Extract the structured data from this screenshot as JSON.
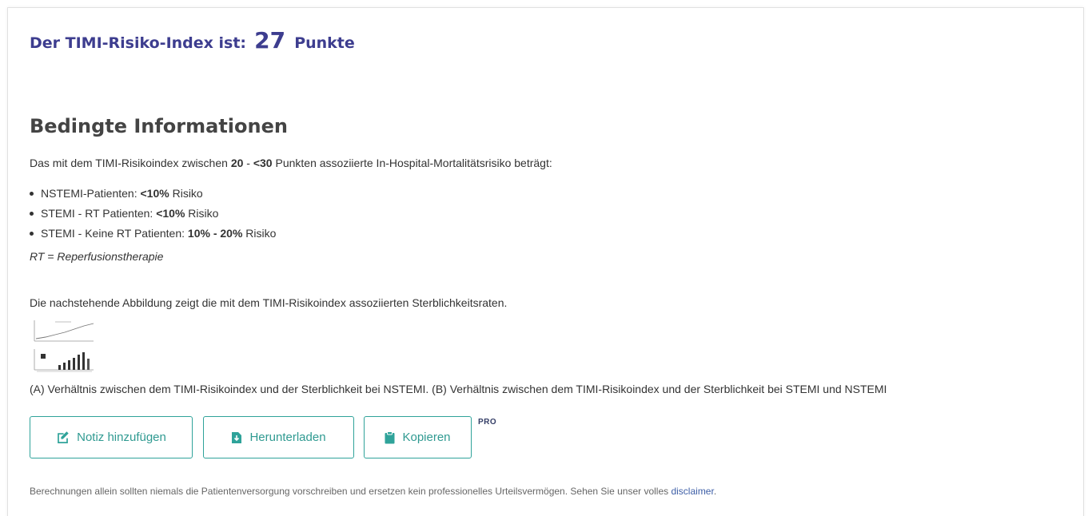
{
  "result": {
    "label": "Der TIMI-Risiko-Index ist:",
    "value": "27",
    "unit": "Punkte"
  },
  "section_title": "Bedingte Informationen",
  "intro": {
    "prefix": "Das mit dem TIMI-Risikoindex zwischen ",
    "range_low": "20",
    "range_sep": " - ",
    "range_high": "<30",
    "suffix": " Punkten assoziierte In-Hospital-Mortalitätsrisiko beträgt:"
  },
  "bullets": [
    {
      "label": "NSTEMI-Patienten: ",
      "value": "<10%",
      "suffix": " Risiko"
    },
    {
      "label": "STEMI - RT Patienten: ",
      "value": "<10%",
      "suffix": " Risiko"
    },
    {
      "label": "STEMI - Keine RT Patienten: ",
      "value": "10% - 20%",
      "suffix": " Risiko"
    }
  ],
  "rt_note": "RT = Reperfusionstherapie",
  "figure_intro": "Die nachstehende Abbildung zeigt die mit dem TIMI-Risikoindex assoziierten Sterblichkeitsraten.",
  "figure_caption": "(A) Verhältnis zwischen dem TIMI-Risikoindex und der Sterblichkeit bei NSTEMI. (B) Verhältnis zwischen dem TIMI-Risikoindex und der Sterblichkeit bei STEMI und NSTEMI",
  "buttons": {
    "add_note": "Notiz hinzufügen",
    "download": "Herunterladen",
    "copy": "Kopieren",
    "pro_badge": "PRO"
  },
  "disclaimer": {
    "text": "Berechnungen allein sollten niemals die Patientenversorgung vorschreiben und ersetzen kein professionelles Urteilsvermögen. Sehen Sie unser volles ",
    "link": "disclaimer",
    "end": "."
  },
  "icons": {
    "add_note": "edit-note-icon",
    "download": "download-icon",
    "copy": "clipboard-icon"
  },
  "colors": {
    "score": "#3d3d8f",
    "accent": "#2fa39a",
    "link": "#3d5ea6"
  }
}
